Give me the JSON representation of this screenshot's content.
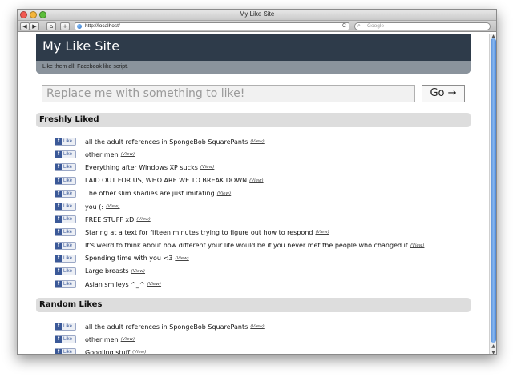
{
  "window": {
    "title": "My Like Site"
  },
  "toolbar": {
    "back_label": "◀",
    "forward_label": "▶",
    "home_label": "⌂",
    "add_label": "+",
    "url": "http://localhost/",
    "reload_label": "C",
    "search_placeholder": "Google"
  },
  "site": {
    "title": "My Like Site",
    "tagline": "Like them all! Facebook like script."
  },
  "like_form": {
    "placeholder": "Replace me with something to like!",
    "go_label": "Go →"
  },
  "freshly_liked": {
    "heading": "Freshly Liked",
    "items": [
      {
        "button": "Like",
        "text": "all the adult references in SpongeBob SquarePants",
        "view": "(View)"
      },
      {
        "button": "Like",
        "text": "other men",
        "view": "(View)"
      },
      {
        "button": "Like",
        "text": "Everything after Windows XP sucks",
        "view": "(View)"
      },
      {
        "button": "Like",
        "text": "LAID OUT FOR US, WHO ARE WE TO BREAK DOWN",
        "view": "(View)"
      },
      {
        "button": "Like",
        "text": "The other slim shadies are just imitating",
        "view": "(View)"
      },
      {
        "button": "Like",
        "text": "you (:",
        "view": "(View)"
      },
      {
        "button": "Like",
        "text": "FREE STUFF xD",
        "view": "(View)"
      },
      {
        "button": "Like",
        "text": "Staring at a text for fifteen minutes trying to figure out how to respond",
        "view": "(View)"
      },
      {
        "button": "Like",
        "text": "It's weird to think about how different your life would be if you never met the people who changed it",
        "view": "(View)"
      },
      {
        "button": "Like",
        "text": "Spending time with you <3",
        "view": "(View)"
      },
      {
        "button": "Like",
        "text": "Large breasts",
        "view": "(View)"
      },
      {
        "button": "Like",
        "text": "Asian smileys ^_^",
        "view": "(View)"
      }
    ]
  },
  "random_likes": {
    "heading": "Random Likes",
    "items": [
      {
        "button": "Like",
        "text": "all the adult references in SpongeBob SquarePants",
        "view": "(View)"
      },
      {
        "button": "Like",
        "text": "other men",
        "view": "(View)"
      },
      {
        "button": "Like",
        "text": "Googling stuff",
        "view": "(View)"
      }
    ]
  },
  "colors": {
    "header_bg": "#2e3b4a",
    "tagline_bg": "#8a939c",
    "section_bg": "#dddddd",
    "facebook_blue": "#3b5998"
  },
  "icons": {
    "facebook": "f",
    "search": "magnifier-icon"
  }
}
